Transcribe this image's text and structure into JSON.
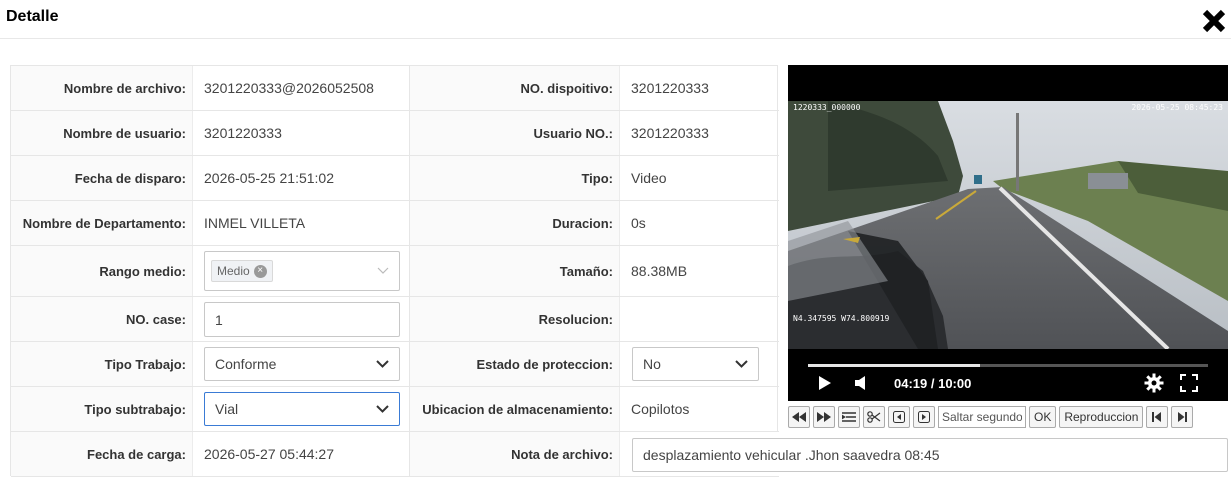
{
  "header": {
    "title": "Detalle"
  },
  "rows": [
    {
      "l1": "Nombre de archivo:",
      "v1": "3201220333@2026052508",
      "l2": "NO. dispoitivo:",
      "v2": "3201220333"
    },
    {
      "l1": "Nombre de usuario:",
      "v1": "3201220333",
      "l2": "Usuario NO.:",
      "v2": "3201220333"
    },
    {
      "l1": "Fecha de disparo:",
      "v1": "2026-05-25 21:51:02",
      "l2": "Tipo:",
      "v2": "Video"
    },
    {
      "l1": "Nombre de Departamento:",
      "v1": "INMEL VILLETA",
      "l2": "Duracion:",
      "v2": "0s"
    },
    {
      "l1": "Rango medio:",
      "v1_tag": "Medio",
      "l2": "Tamaño:",
      "v2": "88.38MB"
    },
    {
      "l1": "NO. case:",
      "v1_input": "1",
      "l2": "Resolucion:",
      "v2": ""
    },
    {
      "l1": "Tipo Trabajo:",
      "v1_select": "Conforme",
      "l2": "Estado de proteccion:",
      "v2_select": "No"
    },
    {
      "l1": "Tipo subtrabajo:",
      "v1_select": "Vial",
      "l2": "Ubicacion de almacenamiento:",
      "v2": "Copilotos"
    },
    {
      "l1": "Fecha de carga:",
      "v1": "2026-05-27 05:44:27",
      "l2": "Nota de archivo:",
      "v2_input": "desplazamiento vehicular .Jhon saavedra 08:45"
    }
  ],
  "video": {
    "overlay_top_left": "1220333_000000",
    "overlay_top_right": "2026-05-25 08:45:23",
    "overlay_bottom_left": "N4.347595 W74.800919",
    "time": "04:19 / 10:00",
    "progress": 0.43
  },
  "toolbar": {
    "seek_placeholder": "Saltar segundos",
    "ok_label": "OK",
    "play_label": "Reproduccion"
  }
}
